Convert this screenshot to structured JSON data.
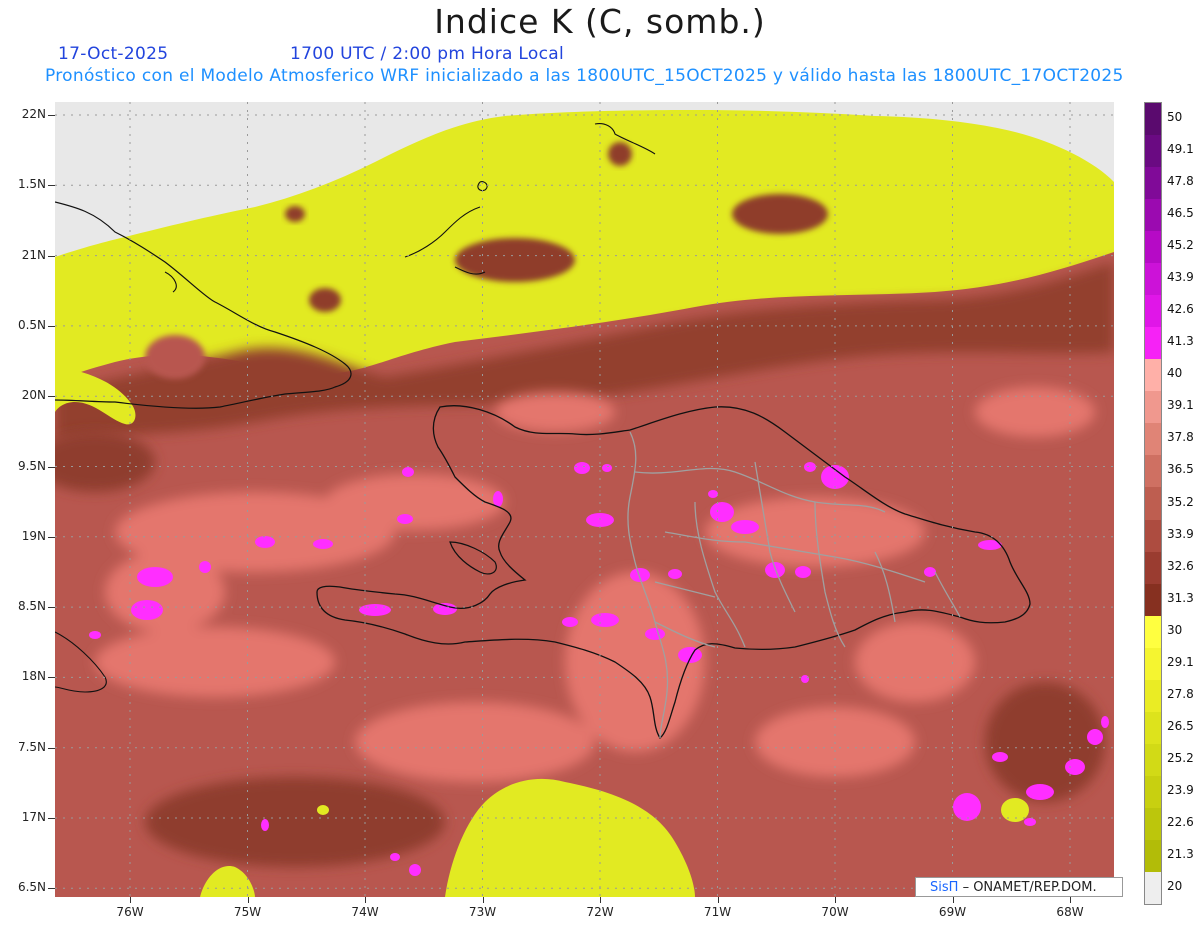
{
  "header": {
    "title": "Indice K (C, somb.)",
    "date": "17-Oct-2025",
    "valid_hour": "1700 UTC / 2:00 pm Hora Local",
    "description": "Pronóstico con el Modelo Atmosferico WRF inicializado a las 1800UTC_15OCT2025 y válido hasta las  1800UTC_17OCT2025"
  },
  "map": {
    "y_ticks": [
      "22N",
      "1.5N",
      "21N",
      "0.5N",
      "20N",
      "9.5N",
      "19N",
      "8.5N",
      "18N",
      "7.5N",
      "17N",
      "6.5N"
    ],
    "x_ticks": [
      "76W",
      "75W",
      "74W",
      "73W",
      "72W",
      "71W",
      "70W",
      "69W",
      "68W"
    ],
    "colors": {
      "background": "#e8e8e8",
      "base": "#b8574f",
      "dark": "#8c3a2a",
      "light": "#e57a72",
      "yellow": "#e8f020",
      "yellow_dim": "#cad22a",
      "magenta": "#ff33ff"
    }
  },
  "colorbar": {
    "labels": [
      "50",
      "49.1",
      "47.8",
      "46.5",
      "45.2",
      "43.9",
      "42.6",
      "41.3",
      "40",
      "39.1",
      "37.8",
      "36.5",
      "35.2",
      "33.9",
      "32.6",
      "31.3",
      "30",
      "29.1",
      "27.8",
      "26.5",
      "25.2",
      "23.9",
      "22.6",
      "21.3",
      "20"
    ],
    "colors": [
      "#5a0a6e",
      "#6a0a82",
      "#800a98",
      "#9b0ab0",
      "#b60ac6",
      "#cc12d8",
      "#e016e8",
      "#f622f6",
      "#ffb0a8",
      "#f0988e",
      "#e08476",
      "#cf7062",
      "#be5e50",
      "#ad4c40",
      "#9a3c30",
      "#863020",
      "#ffff40",
      "#f5f530",
      "#eaec24",
      "#dde31c",
      "#d2da16",
      "#c8d010",
      "#bcc60c",
      "#b2bc08",
      "#eeeeee"
    ]
  },
  "credit": {
    "brand": "SisΠ",
    "text": "– ONAMET/REP.DOM."
  }
}
